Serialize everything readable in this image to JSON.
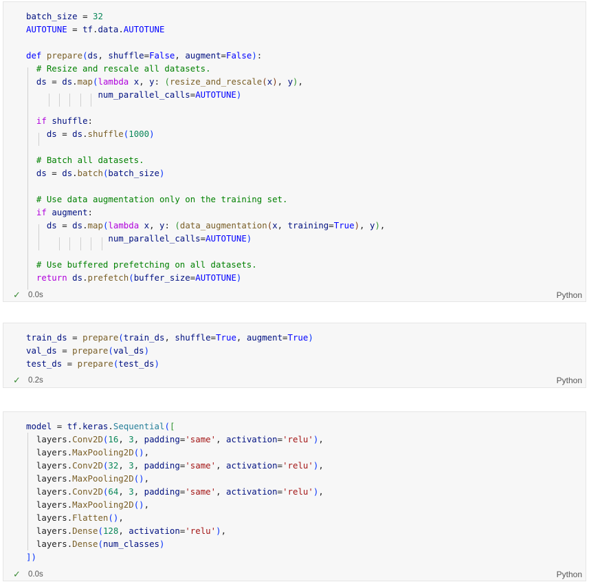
{
  "cells": [
    {
      "exec_time": "0.0s",
      "language": "Python",
      "lines": [
        "batch_size = 32",
        "AUTOTUNE = tf.data.AUTOTUNE",
        "",
        "def prepare(ds, shuffle=False, augment=False):",
        "  # Resize and rescale all datasets.",
        "  ds = ds.map(lambda x, y: (resize_and_rescale(x), y),",
        "              num_parallel_calls=AUTOTUNE)",
        "",
        "  if shuffle:",
        "    ds = ds.shuffle(1000)",
        "",
        "  # Batch all datasets.",
        "  ds = ds.batch(batch_size)",
        "",
        "  # Use data augmentation only on the training set.",
        "  if augment:",
        "    ds = ds.map(lambda x, y: (data_augmentation(x, training=True), y),",
        "                num_parallel_calls=AUTOTUNE)",
        "",
        "  # Use buffered prefetching on all datasets.",
        "  return ds.prefetch(buffer_size=AUTOTUNE)"
      ]
    },
    {
      "exec_time": "0.2s",
      "language": "Python",
      "lines": [
        "train_ds = prepare(train_ds, shuffle=True, augment=True)",
        "val_ds = prepare(val_ds)",
        "test_ds = prepare(test_ds)"
      ]
    },
    {
      "exec_time": "0.0s",
      "language": "Python",
      "lines": [
        "model = tf.keras.Sequential([",
        "  layers.Conv2D(16, 3, padding='same', activation='relu'),",
        "  layers.MaxPooling2D(),",
        "  layers.Conv2D(32, 3, padding='same', activation='relu'),",
        "  layers.MaxPooling2D(),",
        "  layers.Conv2D(64, 3, padding='same', activation='relu'),",
        "  layers.MaxPooling2D(),",
        "  layers.Flatten(),",
        "  layers.Dense(128, activation='relu'),",
        "  layers.Dense(num_classes)",
        "])"
      ]
    }
  ],
  "colors": {
    "keyword": "#af00db",
    "def": "#0000ff",
    "function": "#795e26",
    "variable": "#001080",
    "comment": "#008000",
    "number": "#098658",
    "string": "#a31515",
    "type": "#267f99",
    "check": "#388a34",
    "cell_bg": "#f7f7f7"
  },
  "icons": {
    "status": "check-icon"
  }
}
